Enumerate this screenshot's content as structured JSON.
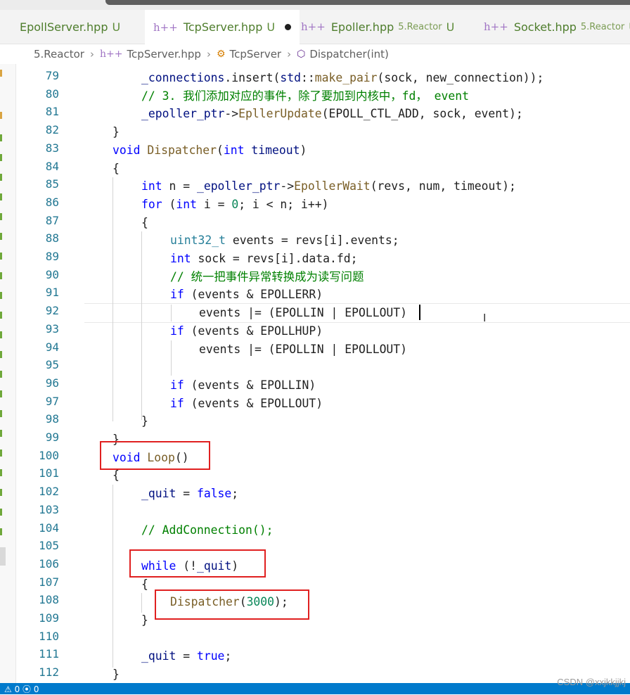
{
  "tabs": [
    {
      "name": "EpollServer.hpp",
      "status": "U",
      "active": false
    },
    {
      "name": "TcpServer.hpp",
      "status": "U",
      "active": true,
      "modified_dot": true
    },
    {
      "name": "Epoller.hpp",
      "dir": "5.Reactor",
      "status": "U",
      "active": false
    },
    {
      "name": "Socket.hpp",
      "dir": "5.Reactor",
      "status": "U",
      "active": false
    }
  ],
  "icons": {
    "header_file": "h++",
    "class": "class-icon",
    "method": "method-icon"
  },
  "breadcrumb": {
    "folder": "5.Reactor",
    "file": "TcpServer.hpp",
    "class": "TcpServer",
    "method": "Dispatcher(int)"
  },
  "editor": {
    "first_line": 79,
    "lines": [
      {
        "n": "79",
        "indent": 2,
        "tokens": [
          [
            "var",
            "_connections"
          ],
          [
            "",
            ".insert("
          ],
          [
            "var",
            "std"
          ],
          [
            "",
            "::"
          ],
          [
            "fn",
            "make_pair"
          ],
          [
            "",
            "(sock, new_connection));"
          ]
        ]
      },
      {
        "n": "80",
        "indent": 2,
        "tokens": [
          [
            "cm",
            "// 3. 我们添加对应的事件，除了要加到内核中，fd， event"
          ]
        ]
      },
      {
        "n": "81",
        "indent": 2,
        "tokens": [
          [
            "var",
            "_epoller_ptr"
          ],
          [
            "",
            "->"
          ],
          [
            "fn",
            "EpllerUpdate"
          ],
          [
            "",
            "(EPOLL_CTL_ADD, sock, event);"
          ]
        ]
      },
      {
        "n": "82",
        "indent": 1,
        "tokens": [
          [
            "",
            "}"
          ]
        ]
      },
      {
        "n": "83",
        "indent": 1,
        "tokens": [
          [
            "kw",
            "void"
          ],
          [
            "",
            " "
          ],
          [
            "fn",
            "Dispatcher"
          ],
          [
            "",
            "("
          ],
          [
            "kw",
            "int"
          ],
          [
            "",
            " "
          ],
          [
            "var",
            "timeout"
          ],
          [
            "",
            ")"
          ]
        ]
      },
      {
        "n": "84",
        "indent": 1,
        "tokens": [
          [
            "",
            "{"
          ]
        ]
      },
      {
        "n": "85",
        "indent": 2,
        "tokens": [
          [
            "kw",
            "int"
          ],
          [
            "",
            " n = "
          ],
          [
            "var",
            "_epoller_ptr"
          ],
          [
            "",
            "->"
          ],
          [
            "fn",
            "EpollerWait"
          ],
          [
            "",
            "(revs, num, timeout);"
          ]
        ]
      },
      {
        "n": "86",
        "indent": 2,
        "tokens": [
          [
            "kw",
            "for"
          ],
          [
            "",
            " ("
          ],
          [
            "kw",
            "int"
          ],
          [
            "",
            " i = "
          ],
          [
            "num",
            "0"
          ],
          [
            "",
            "; i < n; i++)"
          ]
        ]
      },
      {
        "n": "87",
        "indent": 2,
        "tokens": [
          [
            "",
            "{"
          ]
        ]
      },
      {
        "n": "88",
        "indent": 3,
        "tokens": [
          [
            "ty",
            "uint32_t"
          ],
          [
            "",
            " events = revs[i].events;"
          ]
        ]
      },
      {
        "n": "89",
        "indent": 3,
        "tokens": [
          [
            "kw",
            "int"
          ],
          [
            "",
            " sock = revs[i].data.fd;"
          ]
        ]
      },
      {
        "n": "90",
        "indent": 3,
        "tokens": [
          [
            "cm",
            "// 统一把事件异常转换成为读写问题"
          ]
        ]
      },
      {
        "n": "91",
        "indent": 3,
        "tokens": [
          [
            "kw",
            "if"
          ],
          [
            "",
            " (events & EPOLLERR)"
          ]
        ]
      },
      {
        "n": "92",
        "indent": 4,
        "tokens": [
          [
            "",
            "events |= (EPOLLIN | EPOLLOUT)"
          ]
        ]
      },
      {
        "n": "93",
        "indent": 3,
        "tokens": [
          [
            "kw",
            "if"
          ],
          [
            "",
            " (events & EPOLLHUP)"
          ]
        ]
      },
      {
        "n": "94",
        "indent": 4,
        "tokens": [
          [
            "",
            "events |= (EPOLLIN | EPOLLOUT)"
          ]
        ]
      },
      {
        "n": "95",
        "indent": 0,
        "tokens": []
      },
      {
        "n": "96",
        "indent": 3,
        "tokens": [
          [
            "kw",
            "if"
          ],
          [
            "",
            " (events & EPOLLIN)"
          ]
        ]
      },
      {
        "n": "97",
        "indent": 3,
        "tokens": [
          [
            "kw",
            "if"
          ],
          [
            "",
            " (events & EPOLLOUT)"
          ]
        ]
      },
      {
        "n": "98",
        "indent": 2,
        "tokens": [
          [
            "",
            "}"
          ]
        ]
      },
      {
        "n": "99",
        "indent": 1,
        "tokens": [
          [
            "",
            "}"
          ]
        ]
      },
      {
        "n": "100",
        "indent": 1,
        "tokens": [
          [
            "kw",
            "void"
          ],
          [
            "",
            " "
          ],
          [
            "fn",
            "Loop"
          ],
          [
            "",
            "()"
          ]
        ]
      },
      {
        "n": "101",
        "indent": 1,
        "tokens": [
          [
            "",
            "{"
          ]
        ]
      },
      {
        "n": "102",
        "indent": 2,
        "tokens": [
          [
            "var",
            "_quit"
          ],
          [
            "",
            " = "
          ],
          [
            "kw",
            "false"
          ],
          [
            "",
            ";"
          ]
        ]
      },
      {
        "n": "103",
        "indent": 0,
        "tokens": []
      },
      {
        "n": "104",
        "indent": 2,
        "tokens": [
          [
            "cm",
            "// AddConnection();"
          ]
        ]
      },
      {
        "n": "105",
        "indent": 0,
        "tokens": []
      },
      {
        "n": "106",
        "indent": 2,
        "tokens": [
          [
            "kw",
            "while"
          ],
          [
            "",
            " (!"
          ],
          [
            "var",
            "_quit"
          ],
          [
            "",
            ")"
          ]
        ]
      },
      {
        "n": "107",
        "indent": 2,
        "tokens": [
          [
            "",
            "{"
          ]
        ]
      },
      {
        "n": "108",
        "indent": 3,
        "tokens": [
          [
            "fn",
            "Dispatcher"
          ],
          [
            "",
            "("
          ],
          [
            "num",
            "3000"
          ],
          [
            "",
            ");"
          ]
        ]
      },
      {
        "n": "109",
        "indent": 2,
        "tokens": [
          [
            "",
            "}"
          ]
        ]
      },
      {
        "n": "110",
        "indent": 0,
        "tokens": []
      },
      {
        "n": "111",
        "indent": 2,
        "tokens": [
          [
            "var",
            "_quit"
          ],
          [
            "",
            " = "
          ],
          [
            "kw",
            "true"
          ],
          [
            "",
            ";"
          ]
        ]
      },
      {
        "n": "112",
        "indent": 1,
        "tokens": [
          [
            "",
            "}"
          ]
        ]
      }
    ]
  },
  "status": {
    "left": "⚠ 0   ⦿ 0"
  },
  "watermark": "CSDN @xxjkkjjkj",
  "colors": {
    "keyword": "#0000ff",
    "function": "#795e26",
    "comment": "#008000",
    "number": "#098658",
    "line_number": "#237893",
    "highlight_box": "#e02020",
    "statusbar": "#007acc"
  }
}
